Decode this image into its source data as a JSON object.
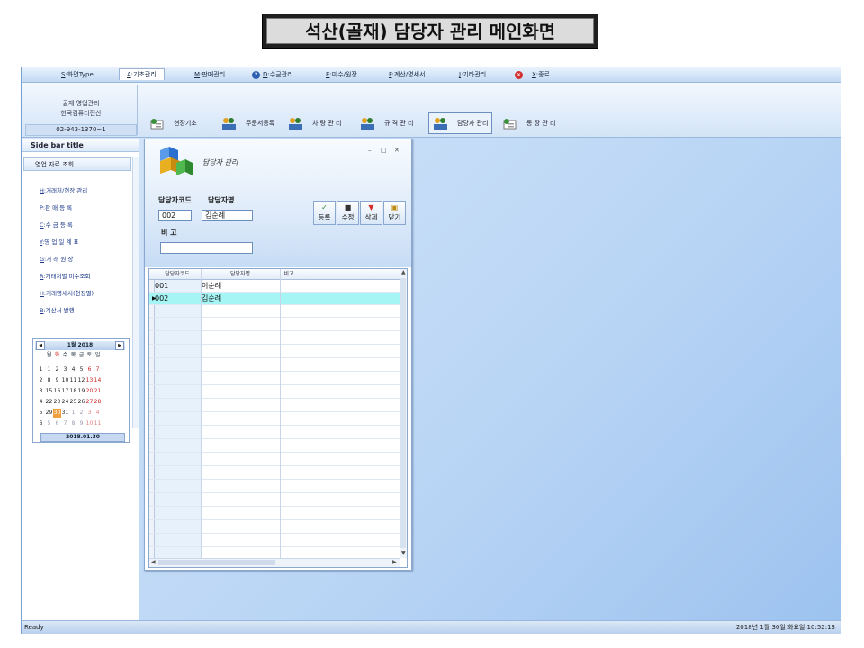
{
  "banner": {
    "title": "석산(골재) 담당자 관리 메인화면"
  },
  "menubar": {
    "items": [
      {
        "key": "S",
        "label": ":화면Type"
      },
      {
        "key": "A",
        "label": ":기초관리"
      },
      {
        "key": "M",
        "label": ":판매관리"
      },
      {
        "key": "D",
        "label": ":수금관리"
      },
      {
        "key": "E",
        "label": ":미수/원장"
      },
      {
        "key": "F",
        "label": ":계산/명세서"
      },
      {
        "key": "J",
        "label": ":기타관리"
      },
      {
        "key": "X",
        "label": ":종료"
      }
    ]
  },
  "ribbon": {
    "company_line1": "골재 영업관리",
    "company_line2": "한국컴퓨터전산",
    "phone": "02-943-1370~1",
    "buttons": [
      {
        "label": "현장기초"
      },
      {
        "label": "주문서등록"
      },
      {
        "label": "차 량 관 리"
      },
      {
        "label": "규 격 관 리"
      },
      {
        "label": "담당자 관리"
      },
      {
        "label": "통 장 관 리"
      }
    ]
  },
  "sidebar": {
    "title": "Side bar title",
    "section": "영업 자료 조회",
    "links": [
      {
        "key": "H",
        "label": ":거래처/현장 관리"
      },
      {
        "key": "P",
        "label": ":판 매 등 록"
      },
      {
        "key": "C",
        "label": ":수 금 등 록"
      },
      {
        "key": "Y",
        "label": ":영 업 일 계 표"
      },
      {
        "key": "G",
        "label": ":거 래 원 장"
      },
      {
        "key": "R",
        "label": ":거래처별 미수조회"
      },
      {
        "key": "H",
        "label": ":거래명세서(현장별)"
      },
      {
        "key": "B",
        "label": ":계산서 발행"
      }
    ]
  },
  "calendar": {
    "month": "1월 2018",
    "weekdays": [
      "월",
      "화",
      "수",
      "목",
      "금",
      "토",
      "일"
    ],
    "weeks": [
      {
        "num": "1",
        "days": [
          "1",
          "2",
          "3",
          "4",
          "5",
          "6",
          "7"
        ]
      },
      {
        "num": "2",
        "days": [
          "8",
          "9",
          "10",
          "11",
          "12",
          "13",
          "14"
        ]
      },
      {
        "num": "3",
        "days": [
          "15",
          "16",
          "17",
          "18",
          "19",
          "20",
          "21"
        ]
      },
      {
        "num": "4",
        "days": [
          "22",
          "23",
          "24",
          "25",
          "26",
          "27",
          "28"
        ]
      },
      {
        "num": "5",
        "days": [
          "29",
          "30",
          "31",
          "1",
          "2",
          "3",
          "4"
        ]
      },
      {
        "num": "6",
        "days": [
          "5",
          "6",
          "7",
          "8",
          "9",
          "10",
          "11"
        ]
      }
    ],
    "today": "2018.01.30"
  },
  "dialog": {
    "title": "담당자 관리",
    "controls": {
      "minimize": "–",
      "maximize": "□",
      "close": "✕"
    },
    "code_label": "담당자코드",
    "name_label": "담당자명",
    "code_value": "002",
    "name_value": "김순례",
    "note_label": "비 고",
    "note_value": "",
    "toolbar": {
      "register": "등록",
      "modify": "수정",
      "delete": "삭제",
      "close": "닫기"
    },
    "grid": {
      "headers": [
        "담당자코드",
        "담당자명",
        "비고"
      ],
      "rows": [
        {
          "code": "001",
          "name": "이순례",
          "note": ""
        },
        {
          "code": "002",
          "name": "김순례",
          "note": ""
        }
      ]
    }
  },
  "statusbar": {
    "left": "Ready",
    "right": "2018년 1월 30일 화요일 10:52:13"
  }
}
